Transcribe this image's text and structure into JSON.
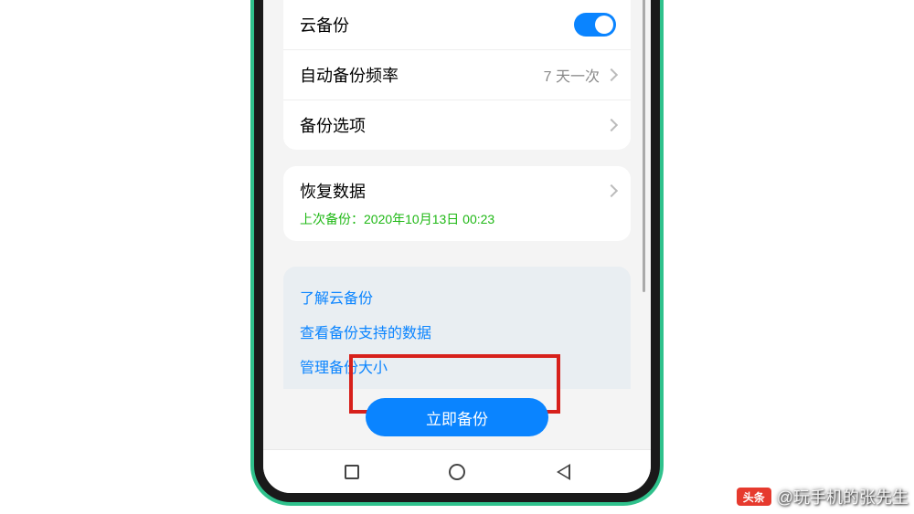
{
  "settings": {
    "cloud_backup": {
      "label": "云备份",
      "enabled": true
    },
    "auto_backup_freq": {
      "label": "自动备份频率",
      "value": "7 天一次"
    },
    "backup_options": {
      "label": "备份选项"
    },
    "restore_data": {
      "label": "恢复数据",
      "last_backup": "上次备份：2020年10月13日 00:23"
    }
  },
  "links": {
    "learn": "了解云备份",
    "supported_data": "查看备份支持的数据",
    "manage_size": "管理备份大小"
  },
  "actions": {
    "backup_now": "立即备份"
  },
  "watermark": {
    "badge": "头条",
    "text": "@玩手机的张先生"
  },
  "colors": {
    "accent_blue": "#0a84ff",
    "frame_green": "#2fc18c",
    "highlight_red": "#d7201b",
    "success_green": "#1fb815"
  }
}
